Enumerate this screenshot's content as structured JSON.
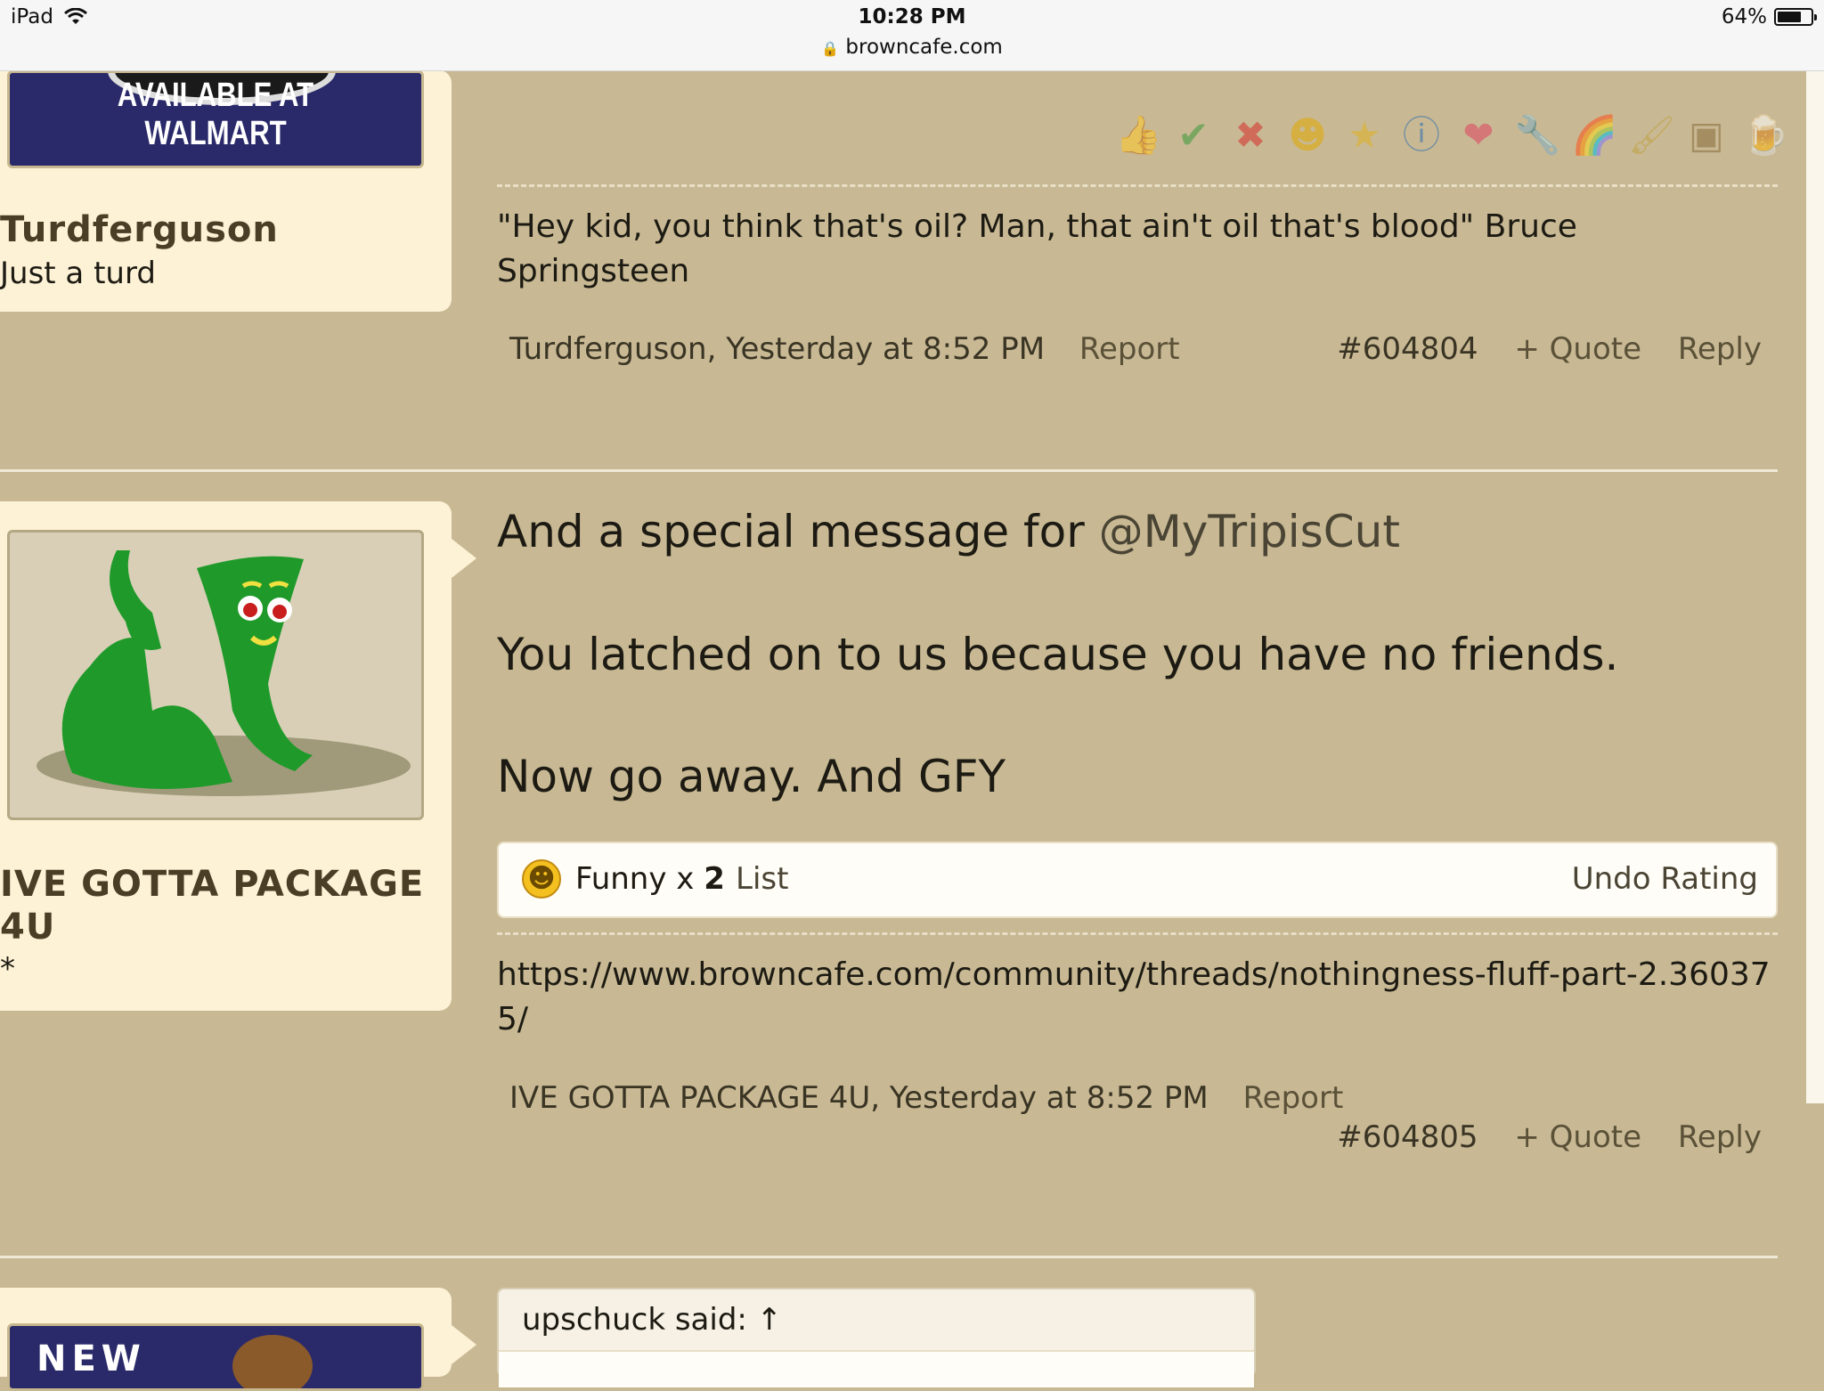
{
  "statusbar": {
    "device": "iPad",
    "time": "10:28 PM",
    "url": "browncafe.com",
    "battery": "64%",
    "battery_level": 0.64
  },
  "post1": {
    "avatar_caption": "AVAILABLE AT WALMART",
    "username": "Turdferguson",
    "user_title": "Just a turd",
    "rating_icons": [
      "like-icon",
      "agree-icon",
      "disagree-icon",
      "funny-icon",
      "winner-icon",
      "informative-icon",
      "love-icon",
      "useful-icon",
      "rainbow-icon",
      "creative-icon",
      "box-icon",
      "beer-icon"
    ],
    "signature": "\"Hey kid, you think that's oil? Man, that ain't oil that's blood\" Bruce Springsteen",
    "author_time": "Turdferguson, Yesterday at 8:52 PM",
    "report": "Report",
    "post_number": "#604804",
    "quote": "+ Quote",
    "reply": "Reply"
  },
  "post2": {
    "username_line1": "IVE GOTTA PACKAGE",
    "username_line2": "4U",
    "user_title": "*",
    "message_intro": "And a special message for ",
    "mention": "@MyTripisCut",
    "line2": "You latched on to us because you have no friends.",
    "line3": "Now go away. And GFY",
    "rating_label": "Funny x ",
    "rating_count": "2",
    "list": "List",
    "undo": "Undo Rating",
    "signature_link": "https://www.browncafe.com/community/threads/nothingness-fluff-part-2.360375/",
    "author_time": "IVE GOTTA PACKAGE 4U, Yesterday at 8:52 PM",
    "report": "Report",
    "post_number": "#604805",
    "quote": "+ Quote",
    "reply": "Reply"
  },
  "post3": {
    "avatar_caption": "NEW",
    "quote_header": "upschuck said: ↑"
  }
}
